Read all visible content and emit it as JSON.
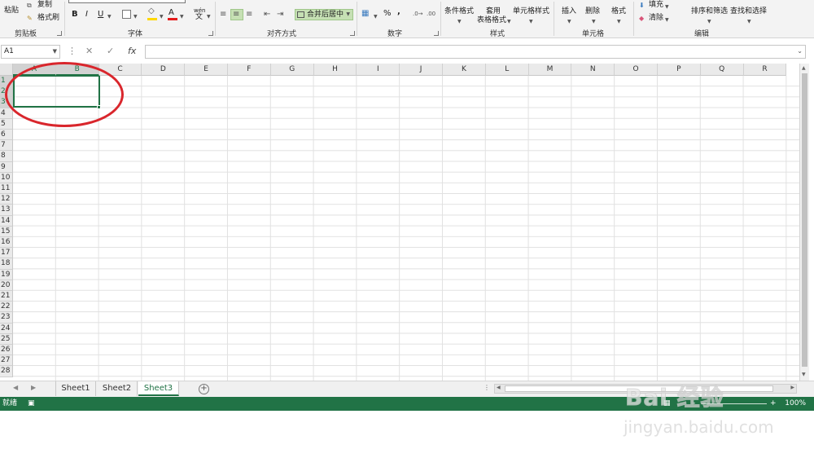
{
  "ribbon": {
    "clipboard": {
      "paste": "粘贴",
      "copy": "复制",
      "format_painter": "格式刷",
      "group": "剪贴板"
    },
    "font": {
      "bold": "B",
      "italic": "I",
      "underline": "U",
      "font_color_glyph": "A",
      "wen": "wén",
      "wen_char": "文",
      "group": "字体"
    },
    "alignment": {
      "merge": "合并后居中",
      "group": "对齐方式"
    },
    "number": {
      "percent": "%",
      "comma": ",",
      "group": "数字"
    },
    "styles": {
      "conditional": "条件格式",
      "table_format_1": "套用",
      "table_format_2": "表格格式",
      "cell_styles": "单元格样式",
      "group": "样式"
    },
    "cells": {
      "insert": "插入",
      "delete": "删除",
      "format": "格式",
      "group": "单元格"
    },
    "editing": {
      "fill": "填充",
      "clear": "清除",
      "sort_filter": "排序和筛选",
      "find_select": "查找和选择",
      "group": "编辑"
    }
  },
  "formula_bar": {
    "name_box": "A1",
    "cancel": "✕",
    "enter": "✓",
    "fx": "fx",
    "value": ""
  },
  "grid": {
    "columns": [
      "A",
      "B",
      "C",
      "D",
      "E",
      "F",
      "G",
      "H",
      "I",
      "J",
      "K",
      "L",
      "M",
      "N",
      "O",
      "P",
      "Q",
      "R"
    ],
    "rows": [
      "1",
      "2",
      "3",
      "4",
      "5",
      "6",
      "7",
      "8",
      "9",
      "10",
      "11",
      "12",
      "13",
      "14",
      "15",
      "16",
      "17",
      "18",
      "19",
      "20",
      "21",
      "22",
      "23",
      "24",
      "25",
      "26",
      "27",
      "28"
    ],
    "selected_range": "A1:B3"
  },
  "sheets": {
    "tabs": [
      "Sheet1",
      "Sheet2",
      "Sheet3"
    ],
    "active": "Sheet3",
    "add": "+"
  },
  "status": {
    "text": "就绪",
    "zoom": "100%",
    "minus": "-",
    "plus": "+"
  },
  "watermark": {
    "logo": "Bai 经验",
    "url": "jingyan.baidu.com"
  },
  "colors": {
    "accent": "#217346",
    "annotation": "#d9262c"
  }
}
